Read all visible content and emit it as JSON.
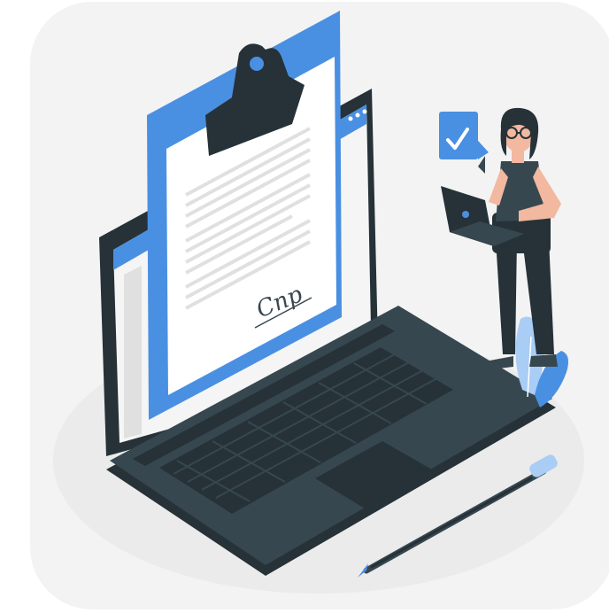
{
  "illustration": {
    "signature_text": "Cnp",
    "colors": {
      "background_card": "#f3f3f3",
      "floor_ellipse": "#ebebeb",
      "laptop_dark": "#37474f",
      "laptop_darker": "#263238",
      "accent_blue": "#4a90e2",
      "accent_blue_light": "#a9cdf5",
      "paper": "#ffffff",
      "paper_lines": "#e0e0e0",
      "skin": "#f2b8a0"
    },
    "icons": [
      "clipboard-icon",
      "check-badge-icon",
      "pen-icon",
      "plant-icon"
    ]
  }
}
